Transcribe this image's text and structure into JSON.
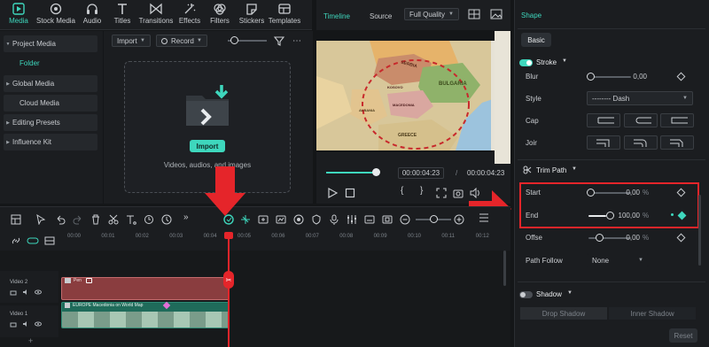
{
  "topbar": {
    "items": [
      {
        "label": "Media",
        "icon": "media-icon",
        "active": true
      },
      {
        "label": "Stock Media",
        "icon": "stock-media-icon"
      },
      {
        "label": "Audio",
        "icon": "audio-icon"
      },
      {
        "label": "Titles",
        "icon": "titles-icon"
      },
      {
        "label": "Transitions",
        "icon": "transitions-icon"
      },
      {
        "label": "Effects",
        "icon": "effects-icon"
      },
      {
        "label": "Filters",
        "icon": "filters-icon"
      },
      {
        "label": "Stickers",
        "icon": "stickers-icon"
      },
      {
        "label": "Templates",
        "icon": "templates-icon"
      }
    ]
  },
  "leftnav": {
    "project_media": "Project Media",
    "folder": "Folder",
    "global_media": "Global Media",
    "cloud_media": "Cloud Media",
    "editing_presets": "Editing Presets",
    "influence_kit": "Influence Kit"
  },
  "media": {
    "import_label": "Import",
    "record_label": "Record",
    "import_button": "Import",
    "hint": "Videos, audios, and images"
  },
  "preview": {
    "tab_timeline": "Timeline",
    "tab_source": "Source",
    "quality": "Full Quality",
    "current_time": "00:00:04:23",
    "separator": "/",
    "total_time": "00:00:04:23",
    "map_labels": [
      "SERBIA",
      "BULGARIA",
      "MACEDONIA",
      "ALBANIA",
      "GREECE",
      "KOSOVO"
    ]
  },
  "shape_panel": {
    "title": "Shape",
    "tab_basic": "Basic",
    "stroke_label": "Stroke",
    "blur_label": "Blur",
    "blur_value": "0,00",
    "style_label": "Style",
    "style_value": "-------- Dash",
    "cap_label": "Cap",
    "join_label": "Joir",
    "trim_path_label": "Trim Path",
    "start_label": "Start",
    "start_value": "0,00",
    "start_unit": "%",
    "start_level": 0.0,
    "end_label": "End",
    "end_value": "100,00",
    "end_unit": "%",
    "end_level": 1.0,
    "offset_label": "Offse",
    "offset_value": "0,00",
    "offset_unit": "%",
    "path_follow_label": "Path Follow",
    "path_follow_value": "None",
    "shadow_label": "Shadow",
    "drop_shadow": "Drop Shadow",
    "inner_shadow": "Inner Shadow",
    "reset": "Reset"
  },
  "timeline": {
    "ruler_labels": [
      "00:00",
      "00:01",
      "00:02",
      "00:03",
      "00:04",
      "00:05",
      "00:06",
      "00:07",
      "00:08",
      "00:09",
      "00:10",
      "00:11",
      "00:12"
    ],
    "video2_label": "Video 2",
    "video1_label": "Video 1",
    "clip2_label": "Pen",
    "clip1_label": "EUROPE Macedonia on World Map"
  },
  "colors": {
    "accent": "#3ed7bd",
    "annotation_red": "#e5252a",
    "clip_shape": "#8a3d3f",
    "clip_video": "#1f6b5a"
  }
}
